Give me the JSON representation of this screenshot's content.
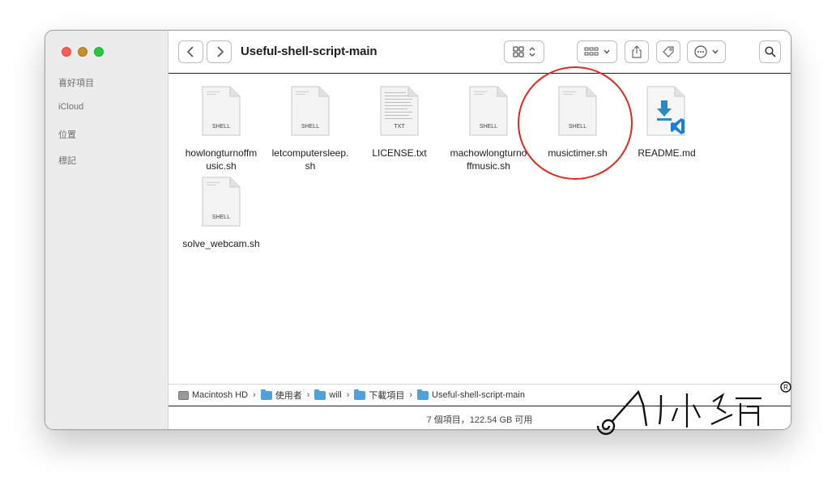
{
  "sidebar": {
    "items": [
      {
        "label": "喜好項目"
      },
      {
        "label": "iCloud"
      },
      {
        "label": "位置"
      },
      {
        "label": "標記"
      }
    ]
  },
  "toolbar": {
    "title": "Useful-shell-script-main",
    "back_icon": "chevron-left-icon",
    "forward_icon": "chevron-right-icon"
  },
  "files": [
    {
      "name": "howlongturnoffmusic.sh",
      "line1": "howlongturnoffm",
      "line2": "usic.sh",
      "kind": "SHELL"
    },
    {
      "name": "letcomputersleep.sh",
      "line1": "letcomputersleep.",
      "line2": "sh",
      "kind": "SHELL"
    },
    {
      "name": "LICENSE.txt",
      "line1": "LICENSE.txt",
      "line2": "",
      "kind": "TXT"
    },
    {
      "name": "machowlongturnoffmusic.sh",
      "line1": "machowlongturno",
      "line2": "ffmusic.sh",
      "kind": "SHELL"
    },
    {
      "name": "musictimer.sh",
      "line1": "musictimer.sh",
      "line2": "",
      "kind": "SHELL"
    },
    {
      "name": "README.md",
      "line1": "README.md",
      "line2": "",
      "kind": "VSCODE"
    },
    {
      "name": "solve_webcam.sh",
      "line1": "solve_webcam.sh",
      "line2": "",
      "kind": "SHELL"
    }
  ],
  "pathbar": {
    "crumbs": [
      "Macintosh HD",
      "使用者",
      "will",
      "下載項目",
      "Useful-shell-script-main"
    ],
    "separator": "›"
  },
  "status": {
    "text": "7 個項目，122.54 GB 可用"
  },
  "colors": {
    "highlight_circle": "#e0281f",
    "folder": "#4ea1dc"
  }
}
